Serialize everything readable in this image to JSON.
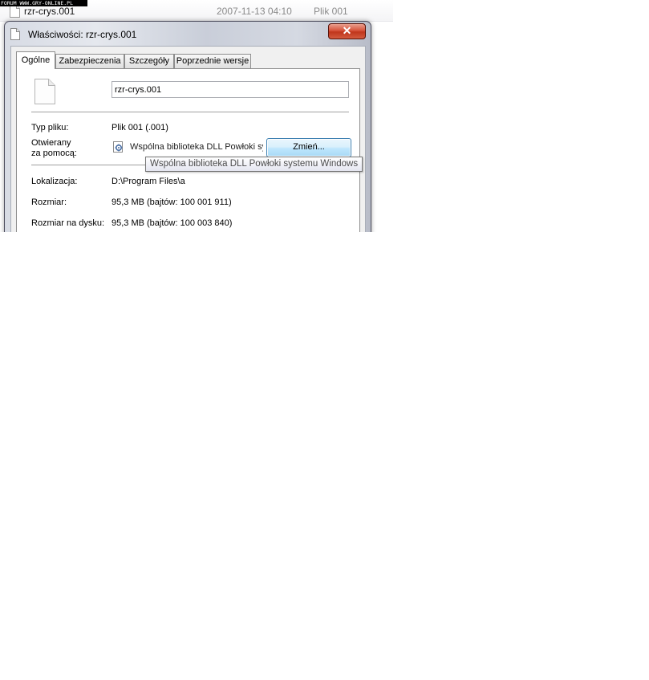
{
  "watermark": "FORUM WWW.GRY-ONLINE.PL",
  "explorer_row": {
    "name": "rzr-crys.001",
    "date": "2007-11-13 04:10",
    "type": "Plik 001"
  },
  "dialog": {
    "title": "Właściwości: rzr-crys.001",
    "close_label": "✕",
    "tabs": [
      "Ogólne",
      "Zabezpieczenia",
      "Szczegóły",
      "Poprzednie wersje"
    ],
    "active_tab": "Ogólne",
    "filename": "rzr-crys.001",
    "file_type_label": "Typ pliku:",
    "file_type_value": "Plik 001 (.001)",
    "opens_with_label_1": "Otwierany",
    "opens_with_label_2": "za pomocą:",
    "opens_with_value": "Wspólna biblioteka DLL Powłoki systemu Windows",
    "change_button": "Zmień...",
    "tooltip": "Wspólna biblioteka DLL Powłoki systemu Windows",
    "location_label": "Lokalizacja:",
    "location_value": "D:\\Program Files\\a",
    "size_label": "Rozmiar:",
    "size_value": "95,3 MB (bajtów: 100 001 911)",
    "size_on_disk_label": "Rozmiar na dysku:",
    "size_on_disk_value": "95,3 MB (bajtów: 100 003 840)"
  }
}
